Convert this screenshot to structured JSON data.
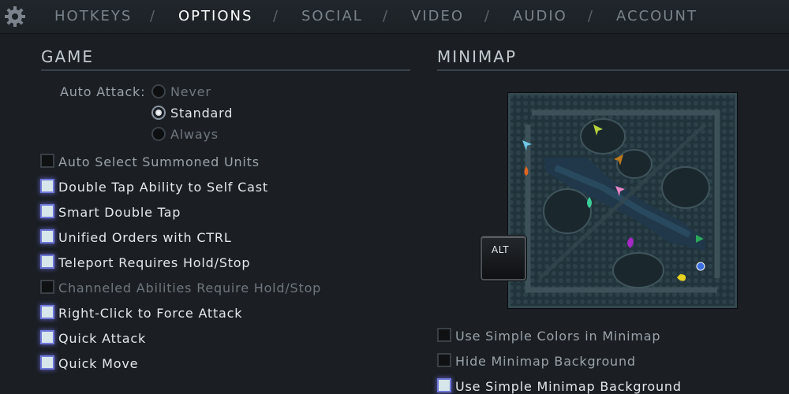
{
  "nav": {
    "tabs": [
      {
        "label": "HOTKEYS",
        "active": false
      },
      {
        "label": "OPTIONS",
        "active": true
      },
      {
        "label": "SOCIAL",
        "active": false
      },
      {
        "label": "VIDEO",
        "active": false
      },
      {
        "label": "AUDIO",
        "active": false
      },
      {
        "label": "ACCOUNT",
        "active": false
      }
    ],
    "separator": "/"
  },
  "game": {
    "title": "GAME",
    "auto_attack": {
      "label": "Auto Attack:",
      "options": [
        {
          "label": "Never",
          "selected": false
        },
        {
          "label": "Standard",
          "selected": true
        },
        {
          "label": "Always",
          "selected": false
        }
      ]
    },
    "checkboxes": [
      {
        "label": "Auto Select Summoned Units",
        "checked": false,
        "disabled": false
      },
      {
        "label": "Double Tap Ability to Self Cast",
        "checked": true,
        "disabled": false
      },
      {
        "label": "Smart Double Tap",
        "checked": true,
        "disabled": false
      },
      {
        "label": "Unified Orders with CTRL",
        "checked": true,
        "disabled": false
      },
      {
        "label": "Teleport Requires Hold/Stop",
        "checked": true,
        "disabled": false
      },
      {
        "label": "Channeled Abilities Require Hold/Stop",
        "checked": false,
        "disabled": true
      },
      {
        "label": "Right-Click to Force Attack",
        "checked": true,
        "disabled": false
      },
      {
        "label": "Quick Attack",
        "checked": true,
        "disabled": false
      },
      {
        "label": "Quick Move",
        "checked": true,
        "disabled": false
      }
    ]
  },
  "minimap": {
    "title": "MINIMAP",
    "alt_key_label": "ALT",
    "checkboxes": [
      {
        "label": "Use Simple Colors in Minimap",
        "checked": false
      },
      {
        "label": "Hide Minimap Background",
        "checked": false
      },
      {
        "label": "Use Simple Minimap Background",
        "checked": true
      }
    ]
  },
  "colors": {
    "background": "#1b1f24",
    "checkbox_glow": "#6f78d9",
    "active_tab": "#ffffff"
  }
}
